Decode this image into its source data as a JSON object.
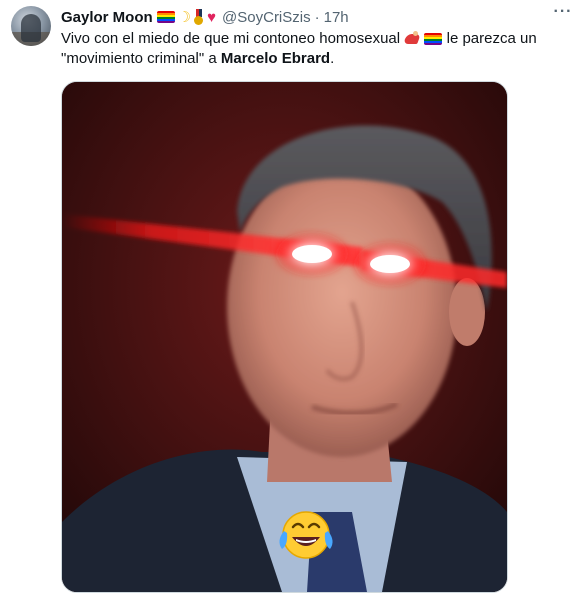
{
  "tweet": {
    "author_name": "Gaylor Moon",
    "author_emojis": [
      "rainbow-flag-icon",
      "crescent-moon-icon",
      "medal-icon",
      "heart-icon"
    ],
    "handle": "@SoyCriSzis",
    "separator": "·",
    "time": "17h",
    "more_label": "···",
    "text_part1": "Vivo con el miedo de que mi contoneo homosexual ",
    "text_part2": " le parezca un \"movimiento criminal\" a ",
    "text_bold": "Marcelo Ebrard",
    "text_end": ".",
    "image_overlay_emoji": "face-with-tears-of-joy-icon"
  },
  "colors": {
    "name": "#0f1419",
    "meta": "#536471",
    "heart": "#e0245e",
    "laser": "#ff1a1a",
    "background": "#ffffff"
  }
}
